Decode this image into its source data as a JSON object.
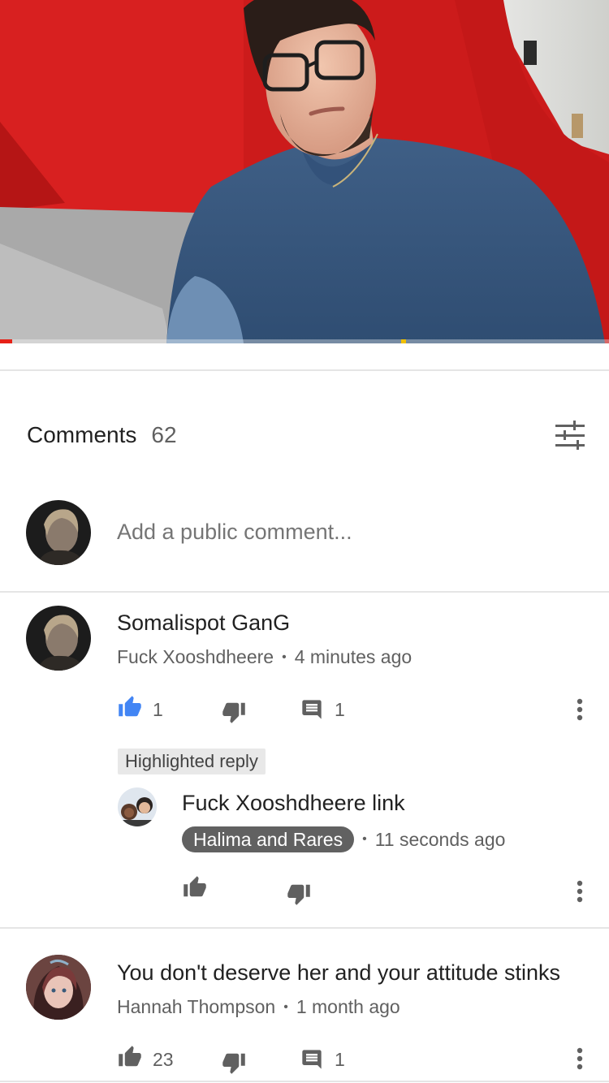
{
  "video": {
    "progress_fraction": 0.02,
    "buffer_marker_fraction": 0.658
  },
  "comments_section": {
    "title": "Comments",
    "count": "62",
    "sort_icon": "sliders-icon",
    "add_comment_placeholder": "Add a public comment..."
  },
  "comments": [
    {
      "text": "Somalispot GanG",
      "author": "Fuck Xooshdheere",
      "time": "4 minutes ago",
      "likes": "1",
      "liked": true,
      "replies": "1",
      "highlighted_label": "Highlighted reply",
      "reply": {
        "text": "Fuck Xooshdheere link",
        "author": "Halima and Rares",
        "time": "11 seconds ago"
      }
    },
    {
      "text": "You don't deserve her and your attitude stinks",
      "author": "Hannah Thompson",
      "time": "1 month ago",
      "likes": "23",
      "liked": false,
      "replies": "1"
    }
  ],
  "colors": {
    "accent_blue": "#4285f4",
    "icon_gray": "#606060",
    "progress_red": "#e62117"
  }
}
